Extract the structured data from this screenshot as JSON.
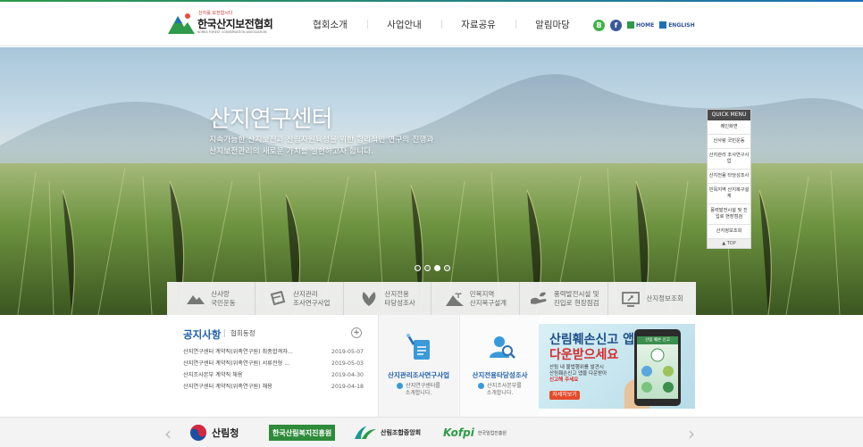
{
  "header": {
    "logo": {
      "small_text": "산지를 보전합시다",
      "name": "한국산지보전협회",
      "english": "KOREA FOREST CONSERVATION ASSOCIATION"
    },
    "nav": [
      "협회소개",
      "사업안내",
      "자료공유",
      "알림마당"
    ],
    "util": {
      "blog": "B",
      "facebook": "f",
      "home": "HOME",
      "english": "ENGLISH"
    }
  },
  "hero": {
    "title": "산지연구센터",
    "desc_line1": "지속가능한 산지보전과 산림자원육성을 위한 합리적인 연구의 진행과",
    "desc_line2": "산지보전관리의 새로운 가치를 실현하고자 합니다.",
    "slides": 4,
    "active_slide": 3
  },
  "quick_menu": {
    "title": "QUICK MENU",
    "items": [
      "메인화면",
      "산사랑 국민운동",
      "산지관리 조사연구사업",
      "산지전용 타당성조사",
      "민목지역 산지복구설계",
      "풍력발전시설 및 진입로 현장점검",
      "산지정보조회"
    ],
    "top": "▲ TOP"
  },
  "business_bar": [
    {
      "line1": "산사랑",
      "line2": "국민운동"
    },
    {
      "line1": "산지관리",
      "line2": "조사연구사업"
    },
    {
      "line1": "산지전용",
      "line2": "타당성조사"
    },
    {
      "line1": "민목지역",
      "line2": "산지복구설계"
    },
    {
      "line1": "풍력발전시설 및",
      "line2": "진입로 현장점검"
    },
    {
      "line1": "산지정보조회",
      "line2": ""
    }
  ],
  "notice": {
    "title": "공지사항",
    "tab2": "협회동정",
    "more": "+",
    "rows": [
      {
        "title": "산지연구센터 계약직(위촉연구원) 최종합격자...",
        "date": "2019-05-07"
      },
      {
        "title": "산지연구센터 계약직(위촉연구원) 서류전형 ...",
        "date": "2019-05-03"
      },
      {
        "title": "산지조사본부 계약직 채용",
        "date": "2019-04-30"
      },
      {
        "title": "산지연구센터 계약직(위촉연구원) 채용",
        "date": "2019-04-18"
      }
    ]
  },
  "cards": [
    {
      "title": "산지관리조사연구사업",
      "desc_line1": "산지연구센터를",
      "desc_line2": "소개합니다."
    },
    {
      "title": "산지전용타당성조사",
      "desc_line1": "산지조사본부를",
      "desc_line2": "소개합니다."
    }
  ],
  "banner": {
    "line1": "산림훼손신고 앱",
    "line2": "다운받으세요",
    "sub1": "산림 내 불법행위를 발견시",
    "sub2": "산림훼손신고 앱을 다운받아",
    "sub3": "신고해 주세요",
    "button": "자세히보기",
    "phone_header": "산림 훼손 신고"
  },
  "partners": {
    "p1": "산림청",
    "p2": "한국산림복지진흥원",
    "p3": "산림조합중앙회",
    "p4_logo": "Kofpi",
    "p4_text": "한국임업진흥원"
  },
  "colors": {
    "accent_blue": "#1d5faa",
    "brand_green": "#2f9a49",
    "banner_red": "#d62b2b"
  }
}
